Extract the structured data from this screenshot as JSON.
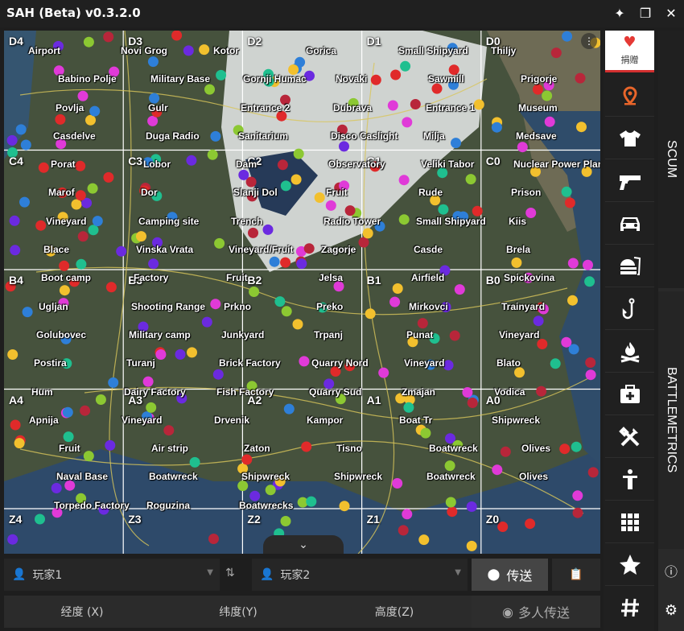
{
  "app": {
    "title": "SAH  (Beta)  v0.3.2.0",
    "pin_icon": "pin-icon",
    "restore_icon": "restore-icon",
    "close_icon": "close-icon"
  },
  "map": {
    "sectors": [
      "D4",
      "D3",
      "D2",
      "D1",
      "D0",
      "C4",
      "C3",
      "C2",
      "C1",
      "C0",
      "B4",
      "B3",
      "B2",
      "B1",
      "B0",
      "A4",
      "A3",
      "A2",
      "A1",
      "A0",
      "Z4",
      "Z3",
      "Z2",
      "Z1",
      "Z0"
    ],
    "places": [
      "Airport",
      "Novi Grog",
      "Kotor",
      "Gorica",
      "Small Shipyard",
      "Thiljy",
      "Babino Polje",
      "Military Base",
      "Gornji Humac",
      "Novaki",
      "Sawmill",
      "Prigorje",
      "Povlja",
      "Gulr",
      "Entrance 2",
      "Dubrava",
      "Entrance 1",
      "Museum",
      "Casdelve",
      "Duga Radio",
      "Sanitarium",
      "Disco Caslight",
      "Milja",
      "Medsave",
      "Porat",
      "Lobor",
      "Dam",
      "Observatory",
      "Veliki Tabor",
      "Nuclear Power Plant",
      "Marof",
      "Dor",
      "Slanji Dol",
      "Fruit",
      "Rude",
      "Prison",
      "Vineyard",
      "Camping site",
      "Trench",
      "Radio Tower",
      "Small Shipyard",
      "Kiis",
      "Blace",
      "Vinska Vrata",
      "Vineyard/Fruit",
      "Zagorje",
      "Casde",
      "Brela",
      "Boot camp",
      "Factory",
      "Fruit",
      "Jelsa",
      "Airfield",
      "Spickovina",
      "Ugljan",
      "Shooting Range",
      "Prkno",
      "Preko",
      "Mirkovci",
      "Trainyard",
      "Golubovec",
      "Military camp",
      "Junkyard",
      "Trpanj",
      "Punat",
      "Vineyard",
      "Postira",
      "Turanj",
      "Brick Factory",
      "Quarry Nord",
      "Vineyard",
      "Blato",
      "Hum",
      "Dairy Factory",
      "Fish Factory",
      "Quarry Sud",
      "Zmajan",
      "Vodica",
      "Apnija",
      "Vineyard",
      "Drvenik",
      "Kampor",
      "Boat Tr",
      "Shipwreck",
      "Fruit",
      "Air strip",
      "Zaton",
      "Tisno",
      "Boatwreck",
      "Olives",
      "Naval Base",
      "Boatwreck",
      "Shipwreck",
      "Shipwreck",
      "Boatwreck",
      "Olives",
      "Torpedo Factory",
      "Roguzina",
      "Boatwrecks"
    ]
  },
  "sidebar": {
    "donate_label": "捐赠",
    "items": [
      "location-pin-icon",
      "tshirt-icon",
      "gun-icon",
      "car-icon",
      "burger-icon",
      "fishhook-icon",
      "campfire-icon",
      "medkit-icon",
      "tools-icon",
      "person-icon",
      "grid-icon",
      "star-icon",
      "hash-icon"
    ]
  },
  "vtabs": {
    "scum": "SCUM",
    "battlemetrics": "BATTLEMETRICS"
  },
  "bottom": {
    "player1": "玩家1",
    "player2": "玩家2",
    "teleport": "传送",
    "x_label": "经度 (X)",
    "y_label": "纬度(Y)",
    "z_label": "高度(Z)",
    "multi_teleport": "多人传送"
  },
  "colors": {
    "accent": "#d32f2f",
    "bg": "#1e1e1e",
    "pin": "#e8652a"
  }
}
